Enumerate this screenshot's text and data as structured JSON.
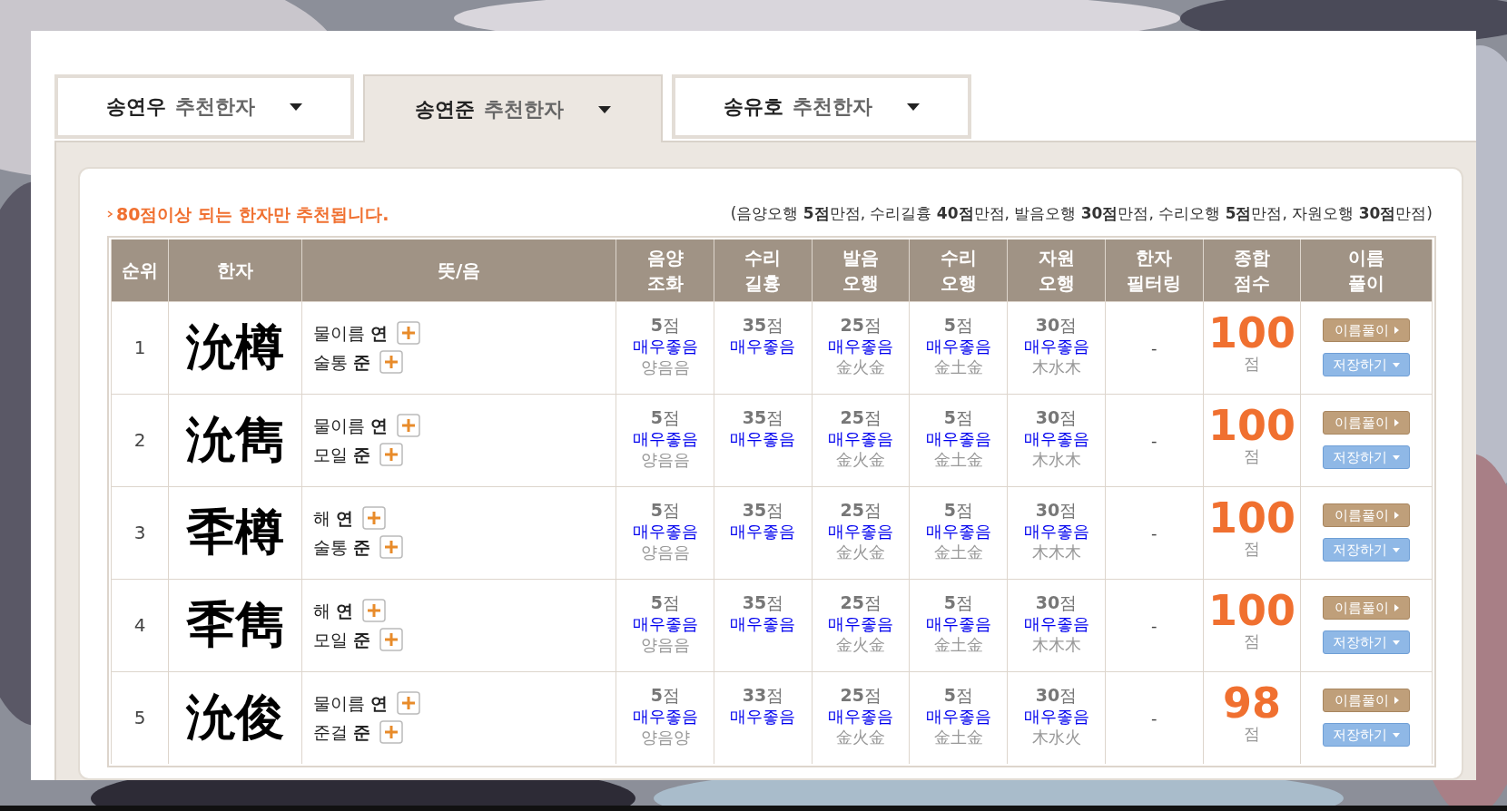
{
  "tabs": [
    {
      "name": "송연우",
      "suffix": "추천한자",
      "selected": false
    },
    {
      "name": "송연준",
      "suffix": "추천한자",
      "selected": true
    },
    {
      "name": "송유호",
      "suffix": "추천한자",
      "selected": false
    }
  ],
  "notice": "80점이상 되는 한자만 추천됩니다.",
  "max_scores": "(음양오행 **5점**만점, 수리길흉 **40점**만점, 발음오행 **30점**만점, 수리오행 **5점**만점, 자원오행 **30점**만점)",
  "table": {
    "columns": [
      "순위",
      "한자",
      "뜻/음",
      "음양\n조화",
      "수리\n길흉",
      "발음\n오행",
      "수리\n오행",
      "자원\n오행",
      "한자\n필터링",
      "종합\n점수",
      "이름\n풀이"
    ],
    "rows": [
      {
        "rank": "1",
        "hanja": "沇樽",
        "readings": [
          {
            "meaning": "물이름",
            "sound": "연"
          },
          {
            "meaning": "술통",
            "sound": "준"
          }
        ],
        "scores": [
          {
            "points": "5",
            "unit": "점",
            "grade": "매우좋음",
            "detail": "양음음"
          },
          {
            "points": "35",
            "unit": "점",
            "grade": "매우좋음"
          },
          {
            "points": "25",
            "unit": "점",
            "grade": "매우좋음",
            "detail": "金火金"
          },
          {
            "points": "5",
            "unit": "점",
            "grade": "매우좋음",
            "detail": "金土金"
          },
          {
            "points": "30",
            "unit": "점",
            "grade": "매우좋음",
            "detail": "木水木"
          }
        ],
        "filter": "-",
        "total": "100",
        "total_unit": "점",
        "buttons": [
          "이름풀이",
          "저장하기"
        ]
      },
      {
        "rank": "2",
        "hanja": "沇雋",
        "readings": [
          {
            "meaning": "물이름",
            "sound": "연"
          },
          {
            "meaning": "모일",
            "sound": "준"
          }
        ],
        "scores": [
          {
            "points": "5",
            "unit": "점",
            "grade": "매우좋음",
            "detail": "양음음"
          },
          {
            "points": "35",
            "unit": "점",
            "grade": "매우좋음"
          },
          {
            "points": "25",
            "unit": "점",
            "grade": "매우좋음",
            "detail": "金火金"
          },
          {
            "points": "5",
            "unit": "점",
            "grade": "매우좋음",
            "detail": "金土金"
          },
          {
            "points": "30",
            "unit": "점",
            "grade": "매우좋음",
            "detail": "木水木"
          }
        ],
        "filter": "-",
        "total": "100",
        "total_unit": "점",
        "buttons": [
          "이름풀이",
          "저장하기"
        ]
      },
      {
        "rank": "3",
        "hanja": "秊樽",
        "readings": [
          {
            "meaning": "해",
            "sound": "연"
          },
          {
            "meaning": "술통",
            "sound": "준"
          }
        ],
        "scores": [
          {
            "points": "5",
            "unit": "점",
            "grade": "매우좋음",
            "detail": "양음음"
          },
          {
            "points": "35",
            "unit": "점",
            "grade": "매우좋음"
          },
          {
            "points": "25",
            "unit": "점",
            "grade": "매우좋음",
            "detail": "金火金"
          },
          {
            "points": "5",
            "unit": "점",
            "grade": "매우좋음",
            "detail": "金土金"
          },
          {
            "points": "30",
            "unit": "점",
            "grade": "매우좋음",
            "detail": "木木木"
          }
        ],
        "filter": "-",
        "total": "100",
        "total_unit": "점",
        "buttons": [
          "이름풀이",
          "저장하기"
        ]
      },
      {
        "rank": "4",
        "hanja": "秊雋",
        "readings": [
          {
            "meaning": "해",
            "sound": "연"
          },
          {
            "meaning": "모일",
            "sound": "준"
          }
        ],
        "scores": [
          {
            "points": "5",
            "unit": "점",
            "grade": "매우좋음",
            "detail": "양음음"
          },
          {
            "points": "35",
            "unit": "점",
            "grade": "매우좋음"
          },
          {
            "points": "25",
            "unit": "점",
            "grade": "매우좋음",
            "detail": "金火金"
          },
          {
            "points": "5",
            "unit": "점",
            "grade": "매우좋음",
            "detail": "金土金"
          },
          {
            "points": "30",
            "unit": "점",
            "grade": "매우좋음",
            "detail": "木木木"
          }
        ],
        "filter": "-",
        "total": "100",
        "total_unit": "점",
        "buttons": [
          "이름풀이",
          "저장하기"
        ]
      },
      {
        "rank": "5",
        "hanja": "沇俊",
        "readings": [
          {
            "meaning": "물이름",
            "sound": "연"
          },
          {
            "meaning": "준걸",
            "sound": "준"
          }
        ],
        "scores": [
          {
            "points": "5",
            "unit": "점",
            "grade": "매우좋음",
            "detail": "양음양"
          },
          {
            "points": "33",
            "unit": "점",
            "grade": "매우좋음"
          },
          {
            "points": "25",
            "unit": "점",
            "grade": "매우좋음",
            "detail": "金火金"
          },
          {
            "points": "5",
            "unit": "점",
            "grade": "매우좋음",
            "detail": "金土金"
          },
          {
            "points": "30",
            "unit": "점",
            "grade": "매우좋음",
            "detail": "木水火"
          }
        ],
        "filter": "-",
        "total": "98",
        "total_unit": "점",
        "buttons": [
          "이름풀이",
          "저장하기"
        ]
      }
    ]
  }
}
